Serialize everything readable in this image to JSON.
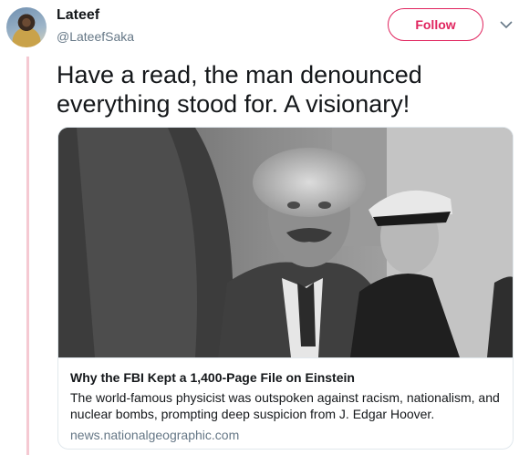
{
  "author": {
    "name": "Lateef",
    "handle": "@LateefSaka"
  },
  "follow_label": "Follow",
  "tweet_text": "Have a read, the man denounced everything stood for. A visionary!",
  "card": {
    "title": "Why the FBI Kept a 1,400-Page File on Einstein",
    "description": "The world-famous physicist was outspoken against racism, nationalism, and nuclear bombs, prompting deep suspicion from J. Edgar Hoover.",
    "domain": "news.nationalgeographic.com"
  },
  "colors": {
    "accent": "#e0245e",
    "thread_line": "#f5c9d2",
    "secondary_text": "#657786"
  },
  "icons": [
    "avatar",
    "chevron-down-icon"
  ]
}
